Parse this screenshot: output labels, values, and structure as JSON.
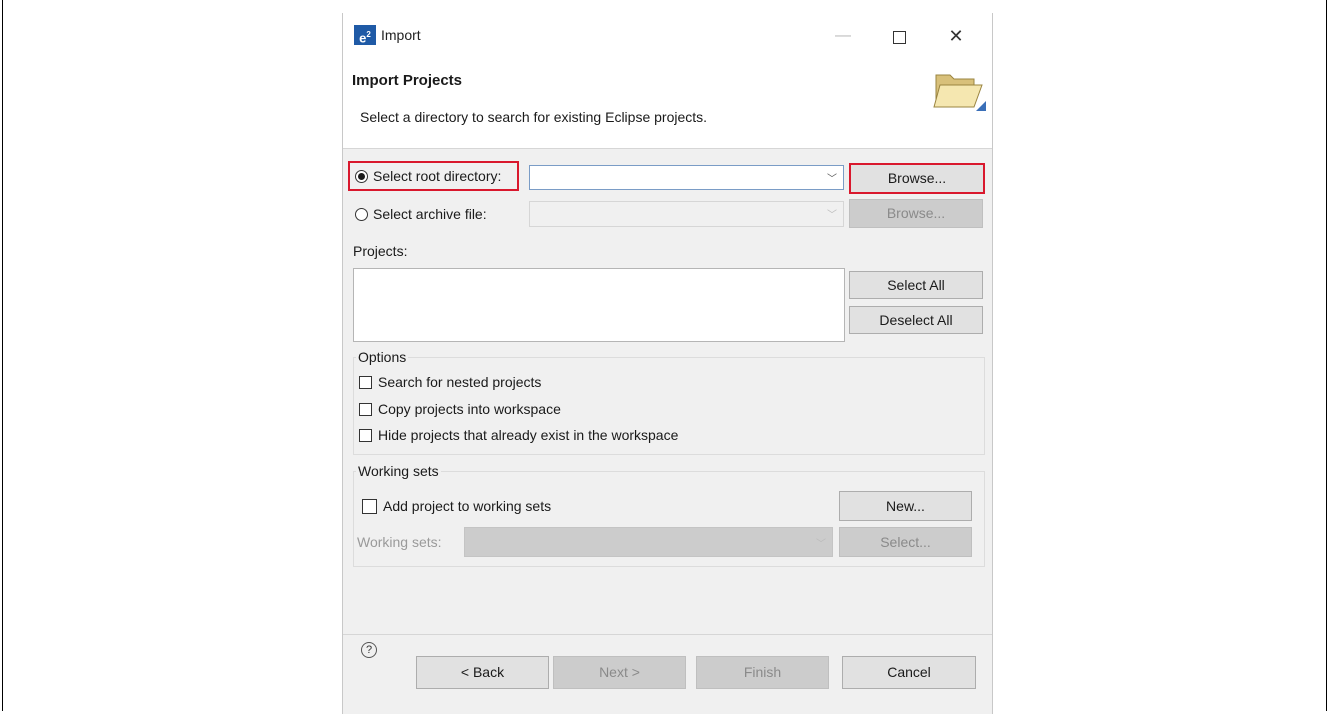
{
  "window": {
    "title": "Import",
    "app_icon": "e²"
  },
  "banner": {
    "title": "Import Projects",
    "description": "Select a directory to search for existing Eclipse projects."
  },
  "source": {
    "root_radio_label": "Select root directory:",
    "archive_radio_label": "Select archive file:",
    "root_value": "",
    "archive_value": "",
    "browse_label": "Browse...",
    "browse_archive_label": "Browse...",
    "selected": "root"
  },
  "projects": {
    "label": "Projects:",
    "select_all": "Select All",
    "deselect_all": "Deselect All"
  },
  "options": {
    "title": "Options",
    "items": [
      {
        "label": "Search for nested projects",
        "checked": false
      },
      {
        "label": "Copy projects into workspace",
        "checked": false
      },
      {
        "label": "Hide projects that already exist in the workspace",
        "checked": false
      }
    ]
  },
  "working_sets": {
    "title": "Working sets",
    "add_label": "Add project to working sets",
    "new_button": "New...",
    "field_label": "Working sets:",
    "select_button": "Select..."
  },
  "footer": {
    "back": "< Back",
    "next": "Next >",
    "finish": "Finish",
    "cancel": "Cancel"
  },
  "colors": {
    "highlight": "#d9182d",
    "dialog_bg": "#f0f0f0"
  }
}
